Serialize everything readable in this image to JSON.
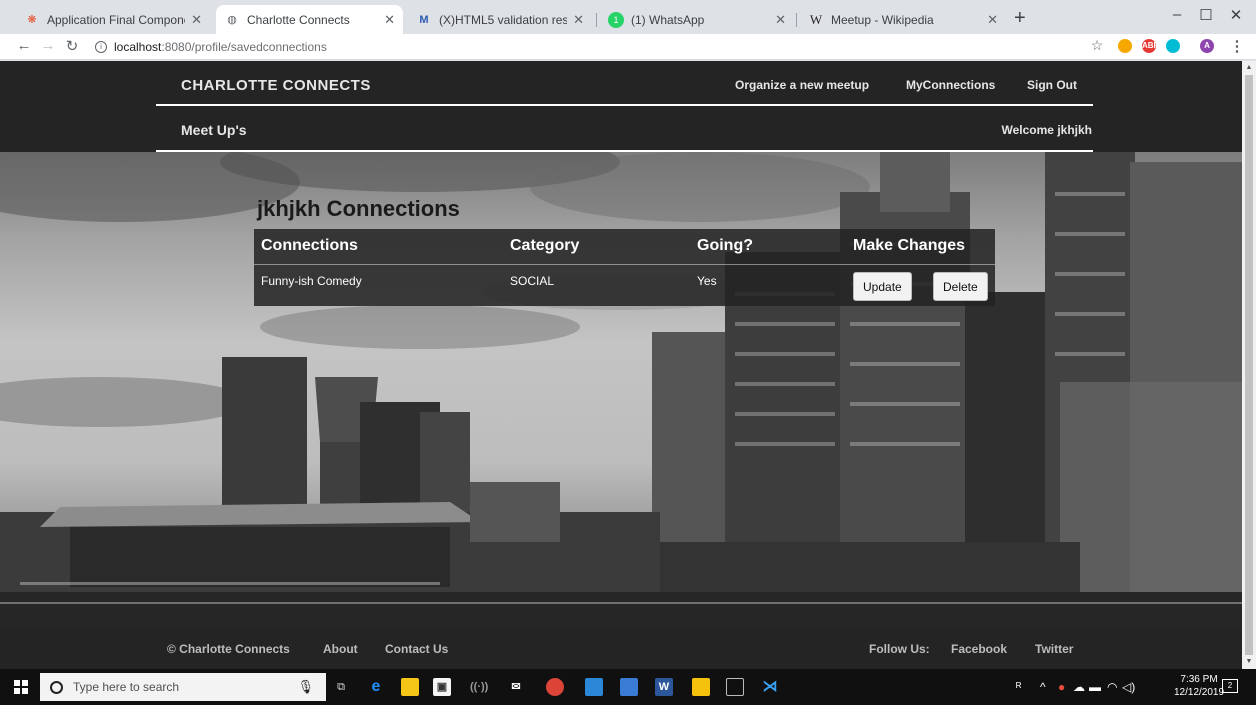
{
  "browser": {
    "tabs": [
      {
        "title": "Application Final Component: 20",
        "icon": "canvas-icon",
        "color": "#e34c26"
      },
      {
        "title": "Charlotte Connects",
        "icon": "globe-icon",
        "color": "#5f6368"
      },
      {
        "title": "(X)HTML5 validation results",
        "icon": "validator-icon",
        "color": "#2a5db0"
      },
      {
        "title": "(1) WhatsApp",
        "icon": "whatsapp-icon",
        "color": "#25d366"
      },
      {
        "title": "Meetup - Wikipedia",
        "icon": "wikipedia-icon",
        "color": "#202124"
      }
    ],
    "address": {
      "host": "localhost",
      "path": ":8080/profile/savedconnections"
    },
    "extension_colors": [
      "#f7a800",
      "#e53935",
      "#00bcd4",
      "#8e44ad"
    ],
    "profile_initial": "A"
  },
  "site": {
    "brand": "CHARLOTTE CONNECTS",
    "nav": {
      "organize": "Organize a new meetup",
      "myconnections": "MyConnections",
      "signout": "Sign Out"
    },
    "subheader": "Meet Up's",
    "welcome_prefix": "Welcome",
    "username": "jkhjkh"
  },
  "connections": {
    "title": "jkhjkh Connections",
    "columns": [
      "Connections",
      "Category",
      "Going?",
      "Make Changes"
    ],
    "rows": [
      {
        "name": "Funny-ish Comedy",
        "category": "SOCIAL",
        "going": "Yes"
      }
    ],
    "update_label": "Update",
    "delete_label": "Delete"
  },
  "footer": {
    "copyright": "© Charlotte Connects",
    "about": "About",
    "contact": "Contact Us",
    "follow": "Follow Us:",
    "facebook": "Facebook",
    "twitter": "Twitter"
  },
  "taskbar": {
    "search_placeholder": "Type here to search",
    "time": "7:36 PM",
    "date": "12/12/2019",
    "notification_count": "2"
  }
}
